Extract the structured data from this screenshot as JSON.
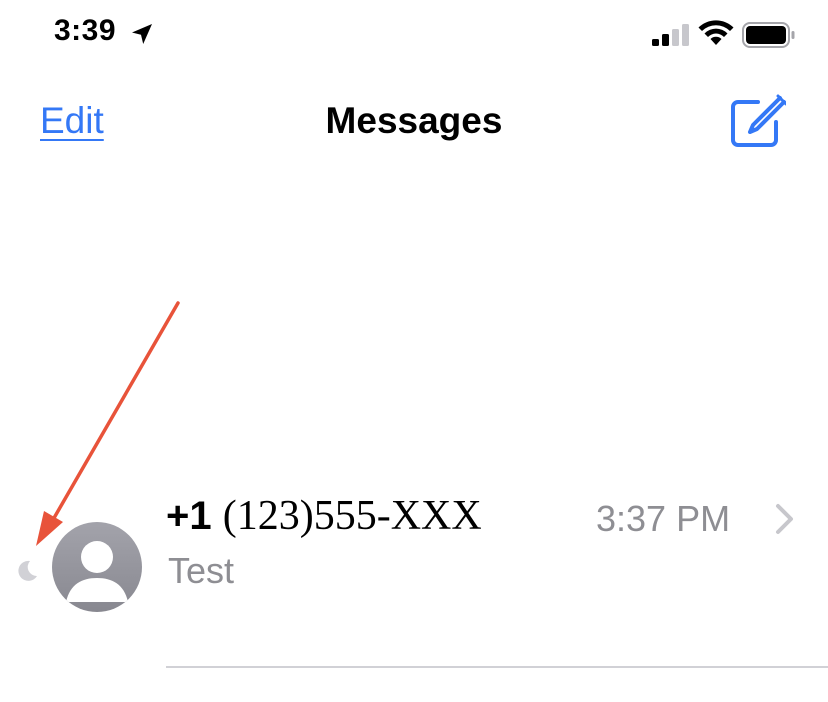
{
  "status_bar": {
    "time": "3:39",
    "icons": [
      "location-arrow-icon",
      "cellular-signal-icon",
      "wifi-icon",
      "battery-icon"
    ]
  },
  "nav": {
    "edit_label": "Edit",
    "title": "Messages",
    "compose_icon": "compose-icon"
  },
  "conversations": [
    {
      "name_prefix": "+1",
      "name_number": "(123)555-XXX",
      "time": "3:37 PM",
      "preview": "Test",
      "muted_icon": "do-not-disturb-moon-icon",
      "avatar_icon": "person-silhouette-icon"
    }
  ],
  "colors": {
    "accent": "#3478f6",
    "secondary_text": "#8e8e93",
    "annotation": "#e8533a",
    "avatar_top": "#a3a3ab",
    "avatar_bottom": "#888890"
  }
}
